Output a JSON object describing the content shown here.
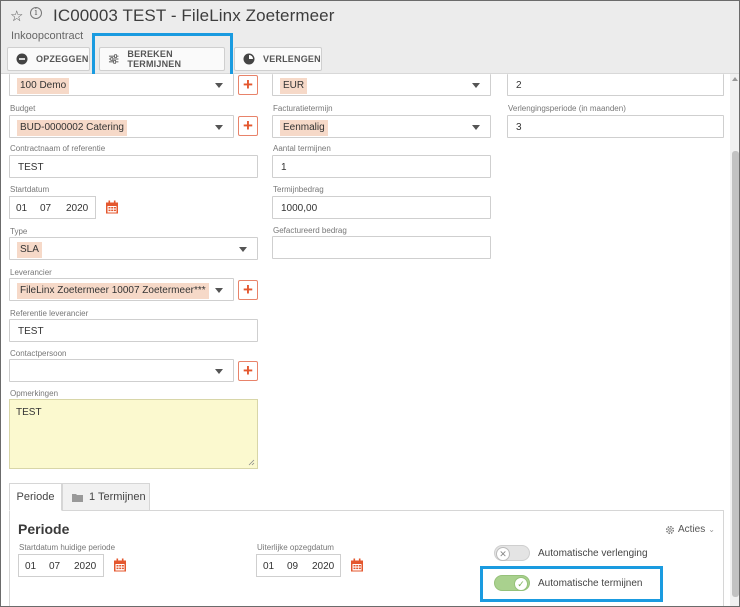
{
  "header": {
    "title": "IC00003 TEST - FileLinx Zoetermeer",
    "subtitle": "Inkoopcontract",
    "info_glyph": "i",
    "buttons": [
      {
        "label": "OPZEGGEN",
        "icon": "minus-circle-icon"
      },
      {
        "label": "BEREKEN TERMIJNEN",
        "icon": "sliders-icon"
      },
      {
        "label": "VERLENGEN",
        "icon": "clock-icon"
      }
    ]
  },
  "form": {
    "left": {
      "top_select": {
        "value": "100 Demo"
      },
      "budget": {
        "label": "Budget",
        "value": "BUD-0000002 Catering"
      },
      "contract_name": {
        "label": "Contractnaam of referentie",
        "value": "TEST"
      },
      "start_date": {
        "label": "Startdatum",
        "day": "01",
        "month": "07",
        "year": "2020"
      },
      "type": {
        "label": "Type",
        "value": "SLA"
      },
      "supplier": {
        "label": "Leverancier",
        "value": "FileLinx Zoetermeer 10007 Zoetermeer***"
      },
      "supplier_ref": {
        "label": "Referentie leverancier",
        "value": "TEST"
      },
      "contact": {
        "label": "Contactpersoon",
        "value": ""
      },
      "remarks": {
        "label": "Opmerkingen",
        "value": "TEST"
      }
    },
    "middle": {
      "currency": {
        "value": "EUR"
      },
      "invoice_term": {
        "label": "Facturatietermijn",
        "value": "Eenmalig"
      },
      "num_terms": {
        "label": "Aantal termijnen",
        "value": "1"
      },
      "term_amount": {
        "label": "Termijnbedrag",
        "value": "1000,00"
      },
      "invoiced_amount": {
        "label": "Gefactureerd bedrag",
        "value": ""
      }
    },
    "right": {
      "top_value": {
        "value": "2"
      },
      "renewal_period": {
        "label": "Verlengingsperiode (in maanden)",
        "value": "3"
      }
    }
  },
  "tabs": [
    {
      "label": "Periode",
      "active": true
    },
    {
      "label": "1  Termijnen",
      "active": false
    }
  ],
  "periode": {
    "title": "Periode",
    "actions_label": "Acties",
    "start_current": {
      "label": "Startdatum huidige periode",
      "day": "01",
      "month": "07",
      "year": "2020"
    },
    "latest_cancel": {
      "label": "Uiterlijke opzegdatum",
      "day": "01",
      "month": "09",
      "year": "2020"
    },
    "auto_renew": {
      "label": "Automatische verlenging",
      "on": false
    },
    "auto_terms": {
      "label": "Automatische termijnen",
      "on": true
    }
  },
  "colors": {
    "accent_highlight": "#1a9be0",
    "chip_bg": "#f6d9c8",
    "plus_red": "#e4572e",
    "toggle_on": "#a9d18e",
    "remarks_bg": "#fbf9cf"
  }
}
